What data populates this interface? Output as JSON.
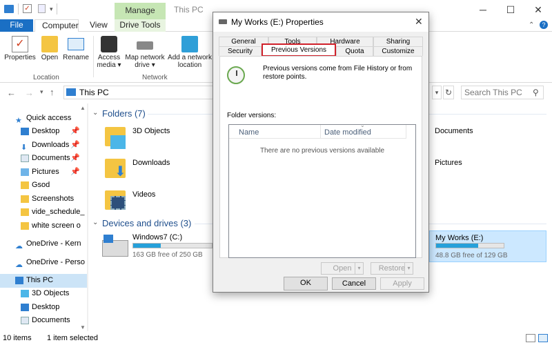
{
  "title": {
    "manage": "Manage",
    "window": "This PC",
    "minimize": "─",
    "maximize": "☐",
    "close": "✕"
  },
  "ribbon": {
    "tabs": {
      "file": "File",
      "computer": "Computer",
      "view": "View",
      "drive_tools": "Drive Tools"
    },
    "buttons": {
      "properties": "Properties",
      "open": "Open",
      "rename": "Rename",
      "access_media": "Access media ▾",
      "map_drive": "Map network drive ▾",
      "add_location": "Add a network location"
    },
    "groups": {
      "location": "Location",
      "network": "Network"
    }
  },
  "address": {
    "path": "This PC",
    "search_placeholder": "Search This PC"
  },
  "nav": {
    "items": [
      "Quick access",
      "Desktop",
      "Downloads",
      "Documents",
      "Pictures",
      "Gsod",
      "Screenshots",
      "vide_schedule_",
      "white screen o",
      "OneDrive - Kern",
      "OneDrive - Perso",
      "This PC",
      "3D Objects",
      "Desktop",
      "Documents"
    ]
  },
  "content": {
    "folders_header": "Folders (7)",
    "folders": [
      "3D Objects",
      "Downloads",
      "Videos",
      "Documents",
      "Pictures"
    ],
    "drives_header": "Devices and drives (3)",
    "drives": [
      {
        "name": "Windows7 (C:)",
        "free": "163 GB free of 250 GB",
        "used_fraction": 0.35
      },
      {
        "name": "My Works (E:)",
        "free": "48.8 GB free of 129 GB",
        "used_fraction": 0.62
      }
    ]
  },
  "status": {
    "items": "10 items",
    "selected": "1 item selected"
  },
  "dialog": {
    "title": "My Works (E:) Properties",
    "tabs_row1": [
      "General",
      "Tools",
      "Hardware",
      "Sharing"
    ],
    "tabs_row2": [
      "Security",
      "Previous Versions",
      "Quota",
      "Customize"
    ],
    "info": "Previous versions come from File History or from restore points.",
    "folder_versions_label": "Folder versions:",
    "col_name": "Name",
    "col_date": "Date modified",
    "empty_msg": "There are no previous versions available",
    "open_btn": "Open",
    "restore_btn": "Restore",
    "ok": "OK",
    "cancel": "Cancel",
    "apply": "Apply"
  },
  "colors": {
    "accent": "#1a6fc4",
    "highlight": "#d0202a",
    "manage": "#c6e6b4"
  }
}
